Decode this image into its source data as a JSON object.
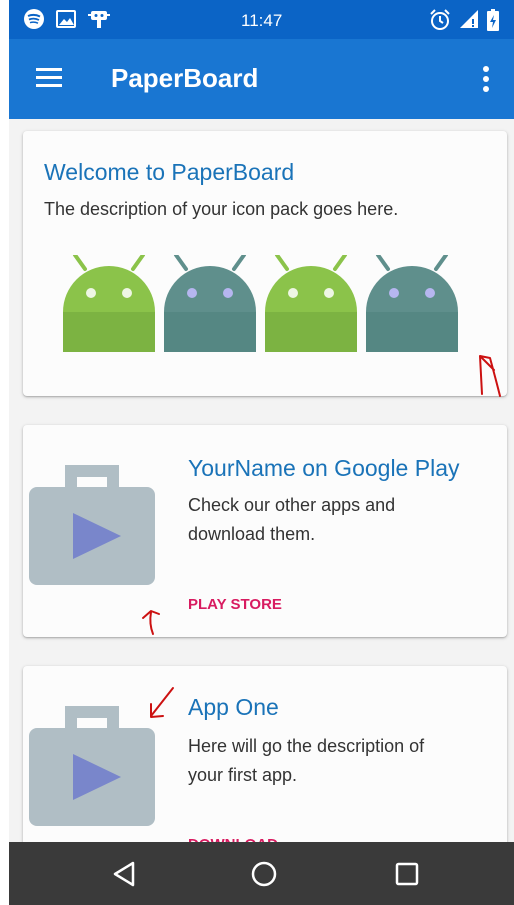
{
  "status_bar": {
    "time": "11:47",
    "left_icons": [
      "spotify-icon",
      "image-icon",
      "debug-icon"
    ],
    "right_icons": [
      "alarm-icon",
      "signal-icon",
      "battery-icon"
    ]
  },
  "app_bar": {
    "title": "PaperBoard",
    "color": "#1976d2",
    "menu_icon": "hamburger-menu-icon",
    "overflow_icon": "more-vert-icon"
  },
  "cards": [
    {
      "title": "Welcome to PaperBoard",
      "description": "The description of your icon pack goes here.",
      "image": "android-robots-illustration"
    },
    {
      "title": "YourName on Google Play",
      "description_lines": [
        "Check our other apps and",
        "download them."
      ],
      "action": "PLAY STORE",
      "image": "play-store-bag-icon"
    },
    {
      "title": "App One",
      "description_lines": [
        "Here will go the description of",
        "your first app."
      ],
      "action": "DOWNLOAD",
      "image": "play-store-bag-icon"
    }
  ],
  "nav_bar": {
    "buttons": [
      "back-icon",
      "home-icon",
      "recents-icon"
    ]
  },
  "colors": {
    "accent": "#d81b60",
    "title_blue": "#1a73b8",
    "annotation_red": "#cc1111"
  }
}
